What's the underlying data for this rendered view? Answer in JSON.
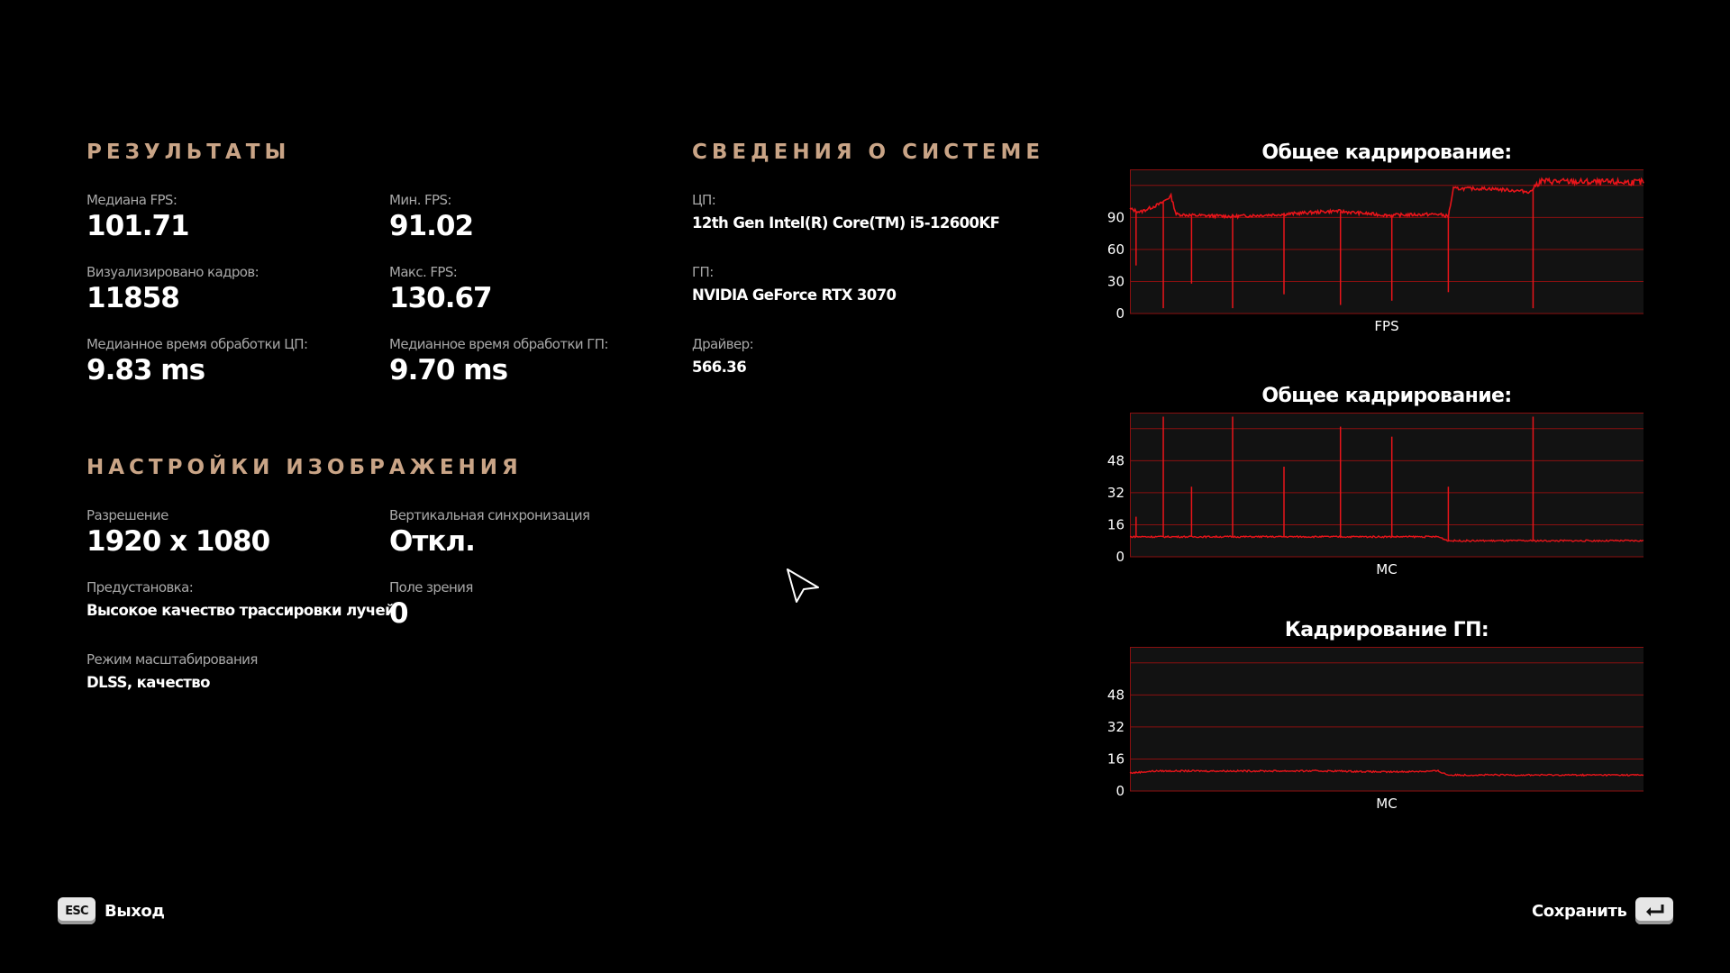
{
  "results": {
    "title": "РЕЗУЛЬТАТЫ",
    "median_fps": {
      "label": "Медиана FPS:",
      "value": "101.71"
    },
    "min_fps": {
      "label": "Мин. FPS:",
      "value": "91.02"
    },
    "frames_rendered": {
      "label": "Визуализировано кадров:",
      "value": "11858"
    },
    "max_fps": {
      "label": "Макс. FPS:",
      "value": "130.67"
    },
    "cpu_time": {
      "label": "Медианное время обработки ЦП:",
      "value": "9.83 ms"
    },
    "gpu_time": {
      "label": "Медианное время обработки ГП:",
      "value": "9.70 ms"
    }
  },
  "image_settings": {
    "title": "НАСТРОЙКИ ИЗОБРАЖЕНИЯ",
    "resolution": {
      "label": "Разрешение",
      "value": "1920 x 1080"
    },
    "vsync": {
      "label": "Вертикальная синхронизация",
      "value": "Откл."
    },
    "preset": {
      "label": "Предустановка:",
      "value": "Высокое качество трассировки лучей"
    },
    "fov": {
      "label": "Поле зрения",
      "value": "0"
    },
    "scaling": {
      "label": "Режим масштабирования",
      "value": "DLSS, качество"
    }
  },
  "system_info": {
    "title": "СВЕДЕНИЯ О СИСТЕМЕ",
    "cpu": {
      "label": "ЦП:",
      "value": "12th Gen Intel(R) Core(TM) i5-12600KF"
    },
    "gpu": {
      "label": "ГП:",
      "value": "NVIDIA GeForce RTX 3070"
    },
    "driver": {
      "label": "Драйвер:",
      "value": "566.36"
    }
  },
  "graphs": [
    {
      "title": "Общее кадрирование:",
      "xlabel": "FPS",
      "yticks": [
        "90",
        "60",
        "30",
        "0"
      ]
    },
    {
      "title": "Общее кадрирование:",
      "xlabel": "МС",
      "yticks": [
        "48",
        "32",
        "16",
        "0"
      ]
    },
    {
      "title": "Кадрирование ГП:",
      "xlabel": "МС",
      "yticks": [
        "48",
        "32",
        "16",
        "0"
      ]
    }
  ],
  "chart_data": [
    {
      "type": "line",
      "title": "Общее кадрирование:",
      "xlabel": "FPS",
      "ylabel": "",
      "ylim": [
        0,
        135
      ],
      "yticks": [
        0,
        30,
        60,
        90
      ],
      "grid": true,
      "x": [
        0,
        0.02,
        0.06,
        0.08,
        0.09,
        0.12,
        0.2,
        0.3,
        0.4,
        0.5,
        0.6,
        0.62,
        0.63,
        0.7,
        0.78,
        0.79,
        0.8,
        0.9,
        1.0
      ],
      "values": [
        98,
        95,
        103,
        110,
        93,
        92,
        91,
        93,
        96,
        92,
        93,
        91,
        117,
        117,
        114,
        120,
        124,
        123,
        123
      ],
      "dips_x": [
        0.012,
        0.065,
        0.12,
        0.2,
        0.3,
        0.41,
        0.51,
        0.62,
        0.785
      ],
      "dips_y": [
        45,
        5,
        28,
        5,
        18,
        8,
        12,
        20,
        5
      ],
      "color": "#e8141a"
    },
    {
      "type": "line",
      "title": "Общее кадрирование:",
      "xlabel": "МС",
      "ylabel": "",
      "ylim": [
        0,
        72
      ],
      "yticks": [
        0,
        16,
        32,
        48
      ],
      "grid": true,
      "x": [
        0,
        0.1,
        0.2,
        0.3,
        0.4,
        0.5,
        0.6,
        0.62,
        0.7,
        0.8,
        0.9,
        1.0
      ],
      "values": [
        10,
        10,
        10,
        10,
        10,
        10,
        10,
        8,
        8,
        8,
        8,
        8
      ],
      "dips_x": [
        0.012,
        0.065,
        0.12,
        0.2,
        0.3,
        0.41,
        0.51,
        0.62,
        0.785
      ],
      "dips_y": [
        20,
        70,
        35,
        70,
        45,
        65,
        60,
        35,
        70
      ],
      "color": "#e8141a"
    },
    {
      "type": "line",
      "title": "Кадрирование ГП:",
      "xlabel": "МС",
      "ylabel": "",
      "ylim": [
        0,
        72
      ],
      "yticks": [
        0,
        16,
        32,
        48
      ],
      "grid": true,
      "x": [
        0,
        0.05,
        0.12,
        0.2,
        0.3,
        0.4,
        0.5,
        0.6,
        0.62,
        0.7,
        0.8,
        0.9,
        1.0
      ],
      "values": [
        9,
        10,
        10,
        10,
        10,
        10,
        9.5,
        10,
        8,
        8,
        8,
        8,
        8
      ],
      "color": "#e8141a"
    }
  ],
  "footer": {
    "exit_key": "ESC",
    "exit_label": "Выход",
    "save_label": "Сохранить"
  },
  "colors": {
    "background": "#000000",
    "section_title": "#c9a486",
    "label": "#a7a7a7",
    "value": "#ffffff",
    "graph_line": "#e8141a",
    "graph_grid": "#8a1010",
    "graph_bg": "#121212"
  }
}
